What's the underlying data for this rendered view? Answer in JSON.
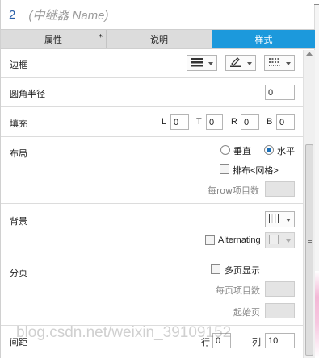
{
  "header": {
    "number": "2",
    "title": "(中继器 Name)"
  },
  "tabs": [
    {
      "label": "属性",
      "marker": "*"
    },
    {
      "label": "说明"
    },
    {
      "label": "样式",
      "active": true
    }
  ],
  "border": {
    "label": "边框"
  },
  "radius": {
    "label": "圆角半径",
    "value": "0"
  },
  "padding": {
    "label": "填充",
    "L": "0",
    "T": "0",
    "R": "0",
    "B": "0",
    "l_label": "L",
    "t_label": "T",
    "r_label": "R",
    "b_label": "B"
  },
  "layout": {
    "label": "布局",
    "vertical": "垂直",
    "horizontal": "水平",
    "grid": "排布<网格>",
    "per_row": "每row项目数"
  },
  "background": {
    "label": "背景",
    "alternating": "Alternating"
  },
  "paging": {
    "label": "分页",
    "multi": "多页显示",
    "per_page": "每页项目数",
    "start_page": "起始页"
  },
  "spacing": {
    "label": "间距",
    "row_label": "行",
    "row_value": "0",
    "col_label": "列",
    "col_value": "10"
  },
  "watermark": "blog.csdn.net/weixin_39109152",
  "colors": {
    "accent": "#1c99dc",
    "radio_fill": "#1a6fb8"
  }
}
